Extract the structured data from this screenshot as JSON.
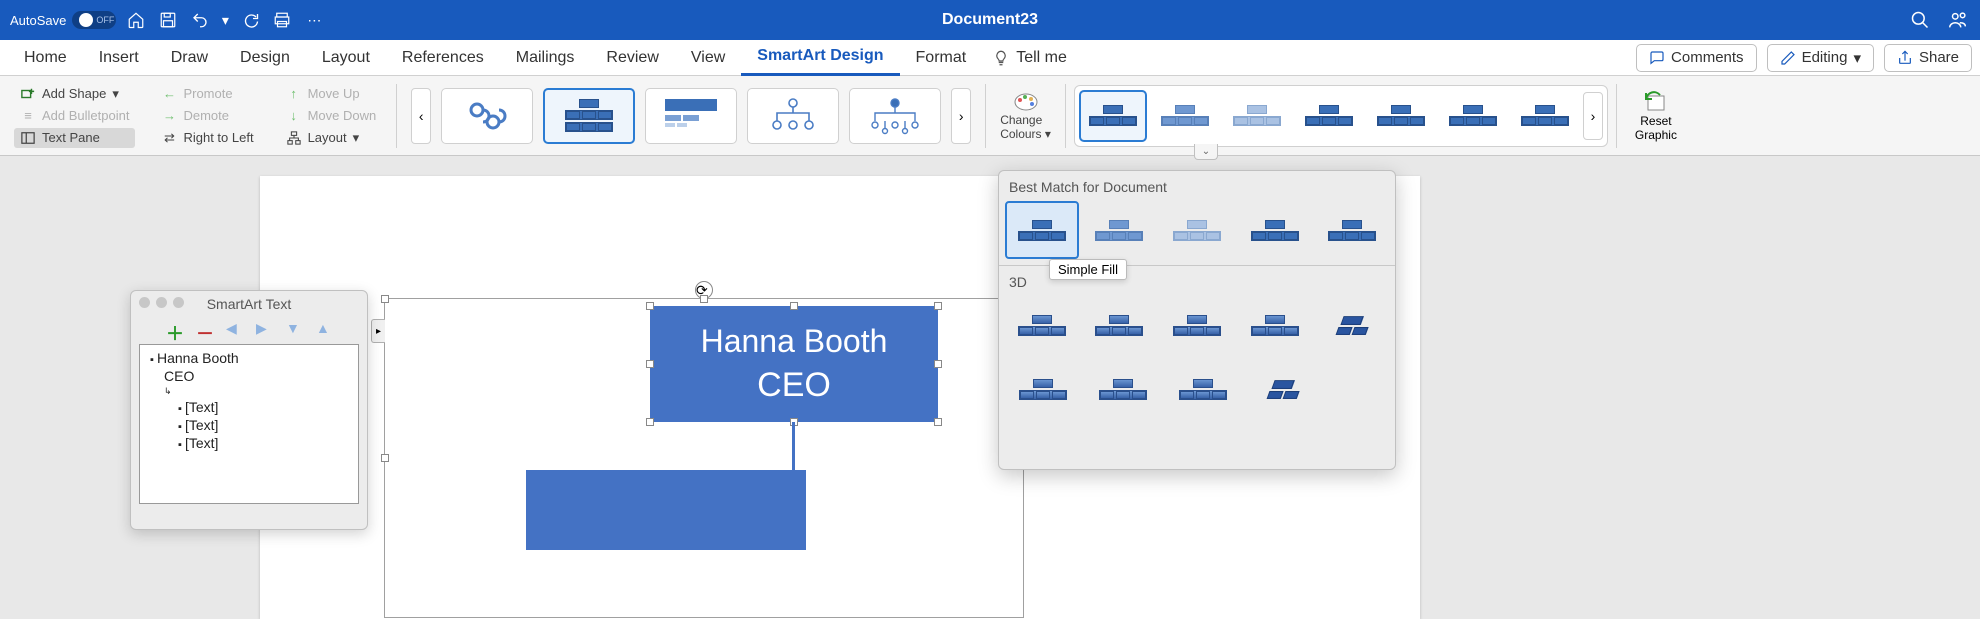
{
  "titlebar": {
    "autosave_label": "AutoSave",
    "autosave_state": "OFF",
    "document_title": "Document23"
  },
  "tabs": {
    "items": [
      "Home",
      "Insert",
      "Draw",
      "Design",
      "Layout",
      "References",
      "Mailings",
      "Review",
      "View",
      "SmartArt Design",
      "Format"
    ],
    "active": "SmartArt Design",
    "tellme": "Tell me",
    "comments": "Comments",
    "editing": "Editing",
    "share": "Share"
  },
  "ribbon": {
    "add_shape": "Add Shape",
    "add_bullet": "Add Bulletpoint",
    "text_pane": "Text Pane",
    "promote": "Promote",
    "demote": "Demote",
    "rtl": "Right to Left",
    "move_up": "Move Up",
    "move_down": "Move Down",
    "layout": "Layout",
    "change_colours_l1": "Change",
    "change_colours_l2": "Colours",
    "reset_l1": "Reset",
    "reset_l2": "Graphic"
  },
  "smartart_panel": {
    "title": "SmartArt Text",
    "items": [
      {
        "level": 1,
        "text": "Hanna Booth"
      },
      {
        "level": 2,
        "text": "CEO",
        "bullet": false
      },
      {
        "level": 2,
        "text": "",
        "bullet": true,
        "tiny": true
      },
      {
        "level": 3,
        "text": "[Text]"
      },
      {
        "level": 3,
        "text": "[Text]"
      },
      {
        "level": 3,
        "text": "[Text]"
      }
    ]
  },
  "canvas": {
    "box_line1": "Hanna Booth",
    "box_line2": "CEO"
  },
  "dropdown": {
    "section1": "Best Match for Document",
    "section2": "3D",
    "tooltip": "Simple Fill"
  }
}
